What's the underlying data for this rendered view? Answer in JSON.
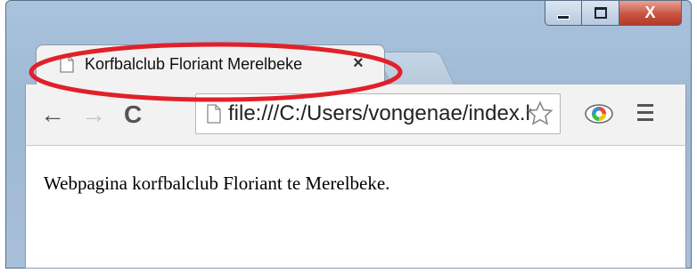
{
  "window": {
    "controls": {
      "minimize_icon": "minimize-icon",
      "maximize_icon": "maximize-icon",
      "close_glyph": "X"
    }
  },
  "tab": {
    "title": "Korfbalclub Floriant Merelbeke",
    "close_glyph": "×",
    "icon": "page-icon"
  },
  "toolbar": {
    "back_glyph": "←",
    "forward_glyph": "→",
    "reload_glyph": "C",
    "address": "file:///C:/Users/vongenae/index.html",
    "icons": [
      "back-arrow-icon",
      "forward-arrow-icon",
      "reload-icon",
      "page-icon",
      "star-icon",
      "eye-extension-icon",
      "menu-icon"
    ]
  },
  "page": {
    "body_text": "Webpagina korfbalclub Floriant te Merelbeke."
  },
  "annotation": {
    "highlight_color": "#e0202a"
  },
  "colors": {
    "window_frame": "#a9c2dd",
    "tab_bg": "#f2f2f2",
    "close_red": "#c8543f"
  }
}
